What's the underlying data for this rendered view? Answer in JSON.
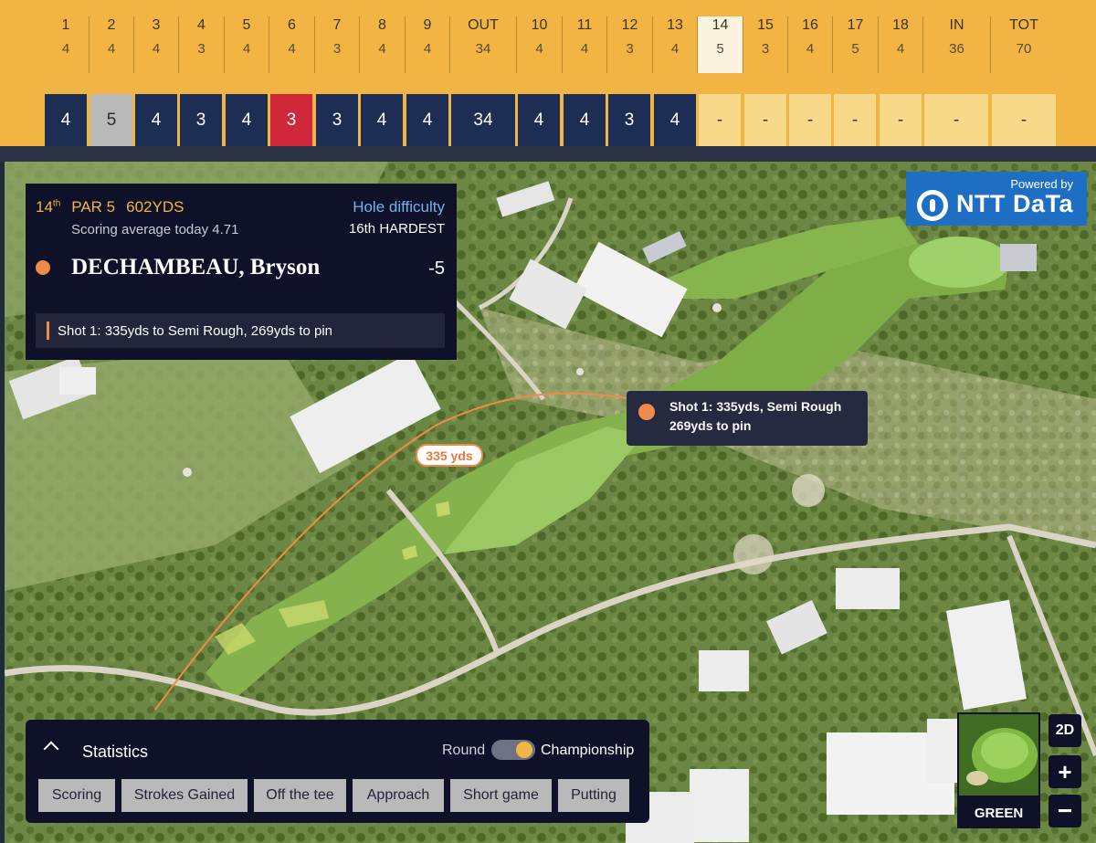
{
  "scorecard": {
    "holes": [
      {
        "num": "1",
        "par": "4"
      },
      {
        "num": "2",
        "par": "4"
      },
      {
        "num": "3",
        "par": "4"
      },
      {
        "num": "4",
        "par": "3"
      },
      {
        "num": "5",
        "par": "4"
      },
      {
        "num": "6",
        "par": "4"
      },
      {
        "num": "7",
        "par": "3"
      },
      {
        "num": "8",
        "par": "4"
      },
      {
        "num": "9",
        "par": "4"
      },
      {
        "num": "OUT",
        "par": "34"
      },
      {
        "num": "10",
        "par": "4"
      },
      {
        "num": "11",
        "par": "4"
      },
      {
        "num": "12",
        "par": "3"
      },
      {
        "num": "13",
        "par": "4"
      },
      {
        "num": "14",
        "par": "5"
      },
      {
        "num": "15",
        "par": "3"
      },
      {
        "num": "16",
        "par": "4"
      },
      {
        "num": "17",
        "par": "5"
      },
      {
        "num": "18",
        "par": "4"
      },
      {
        "num": "IN",
        "par": "36"
      },
      {
        "num": "TOT",
        "par": "70"
      }
    ],
    "scores": [
      "4",
      "5",
      "4",
      "3",
      "4",
      "3",
      "3",
      "4",
      "4",
      "34",
      "4",
      "4",
      "3",
      "4",
      "-",
      "-",
      "-",
      "-",
      "-",
      "-",
      "-"
    ],
    "current_hole": "14"
  },
  "info": {
    "hole_number": "14",
    "hole_suffix": "th",
    "par": "PAR 5",
    "yardage": "602YDS",
    "scoring_average": "Scoring average today 4.71",
    "difficulty_label": "Hole difficulty",
    "difficulty_value": "16th HARDEST",
    "player_name": "DECHAMBEAU, Bryson",
    "player_score": "-5",
    "shot_summary": "Shot 1: 335yds to Semi Rough, 269yds to pin"
  },
  "sponsor": {
    "powered_by": "Powered by",
    "brand": "NTT DaTa"
  },
  "map": {
    "tooltip_line1": "Shot 1: 335yds, Semi Rough",
    "tooltip_line2": "269yds to pin",
    "distance_label": "335 yds"
  },
  "stats": {
    "title": "Statistics",
    "toggle_left": "Round",
    "toggle_right": "Championship",
    "tabs": [
      "Scoring",
      "Strokes Gained",
      "Off the tee",
      "Approach",
      "Short game",
      "Putting"
    ]
  },
  "controls": {
    "view_mode": "2D",
    "zoom_in": "+",
    "zoom_out": "−",
    "green_label": "GREEN"
  },
  "colors": {
    "scorecard_bg": "#f2b544",
    "navy_score": "#1c2e54",
    "bogey_grey": "#b9b9b9",
    "birdie_red": "#d0283a",
    "player_orange": "#f08a4b",
    "panel_bg": "#0e1128"
  }
}
